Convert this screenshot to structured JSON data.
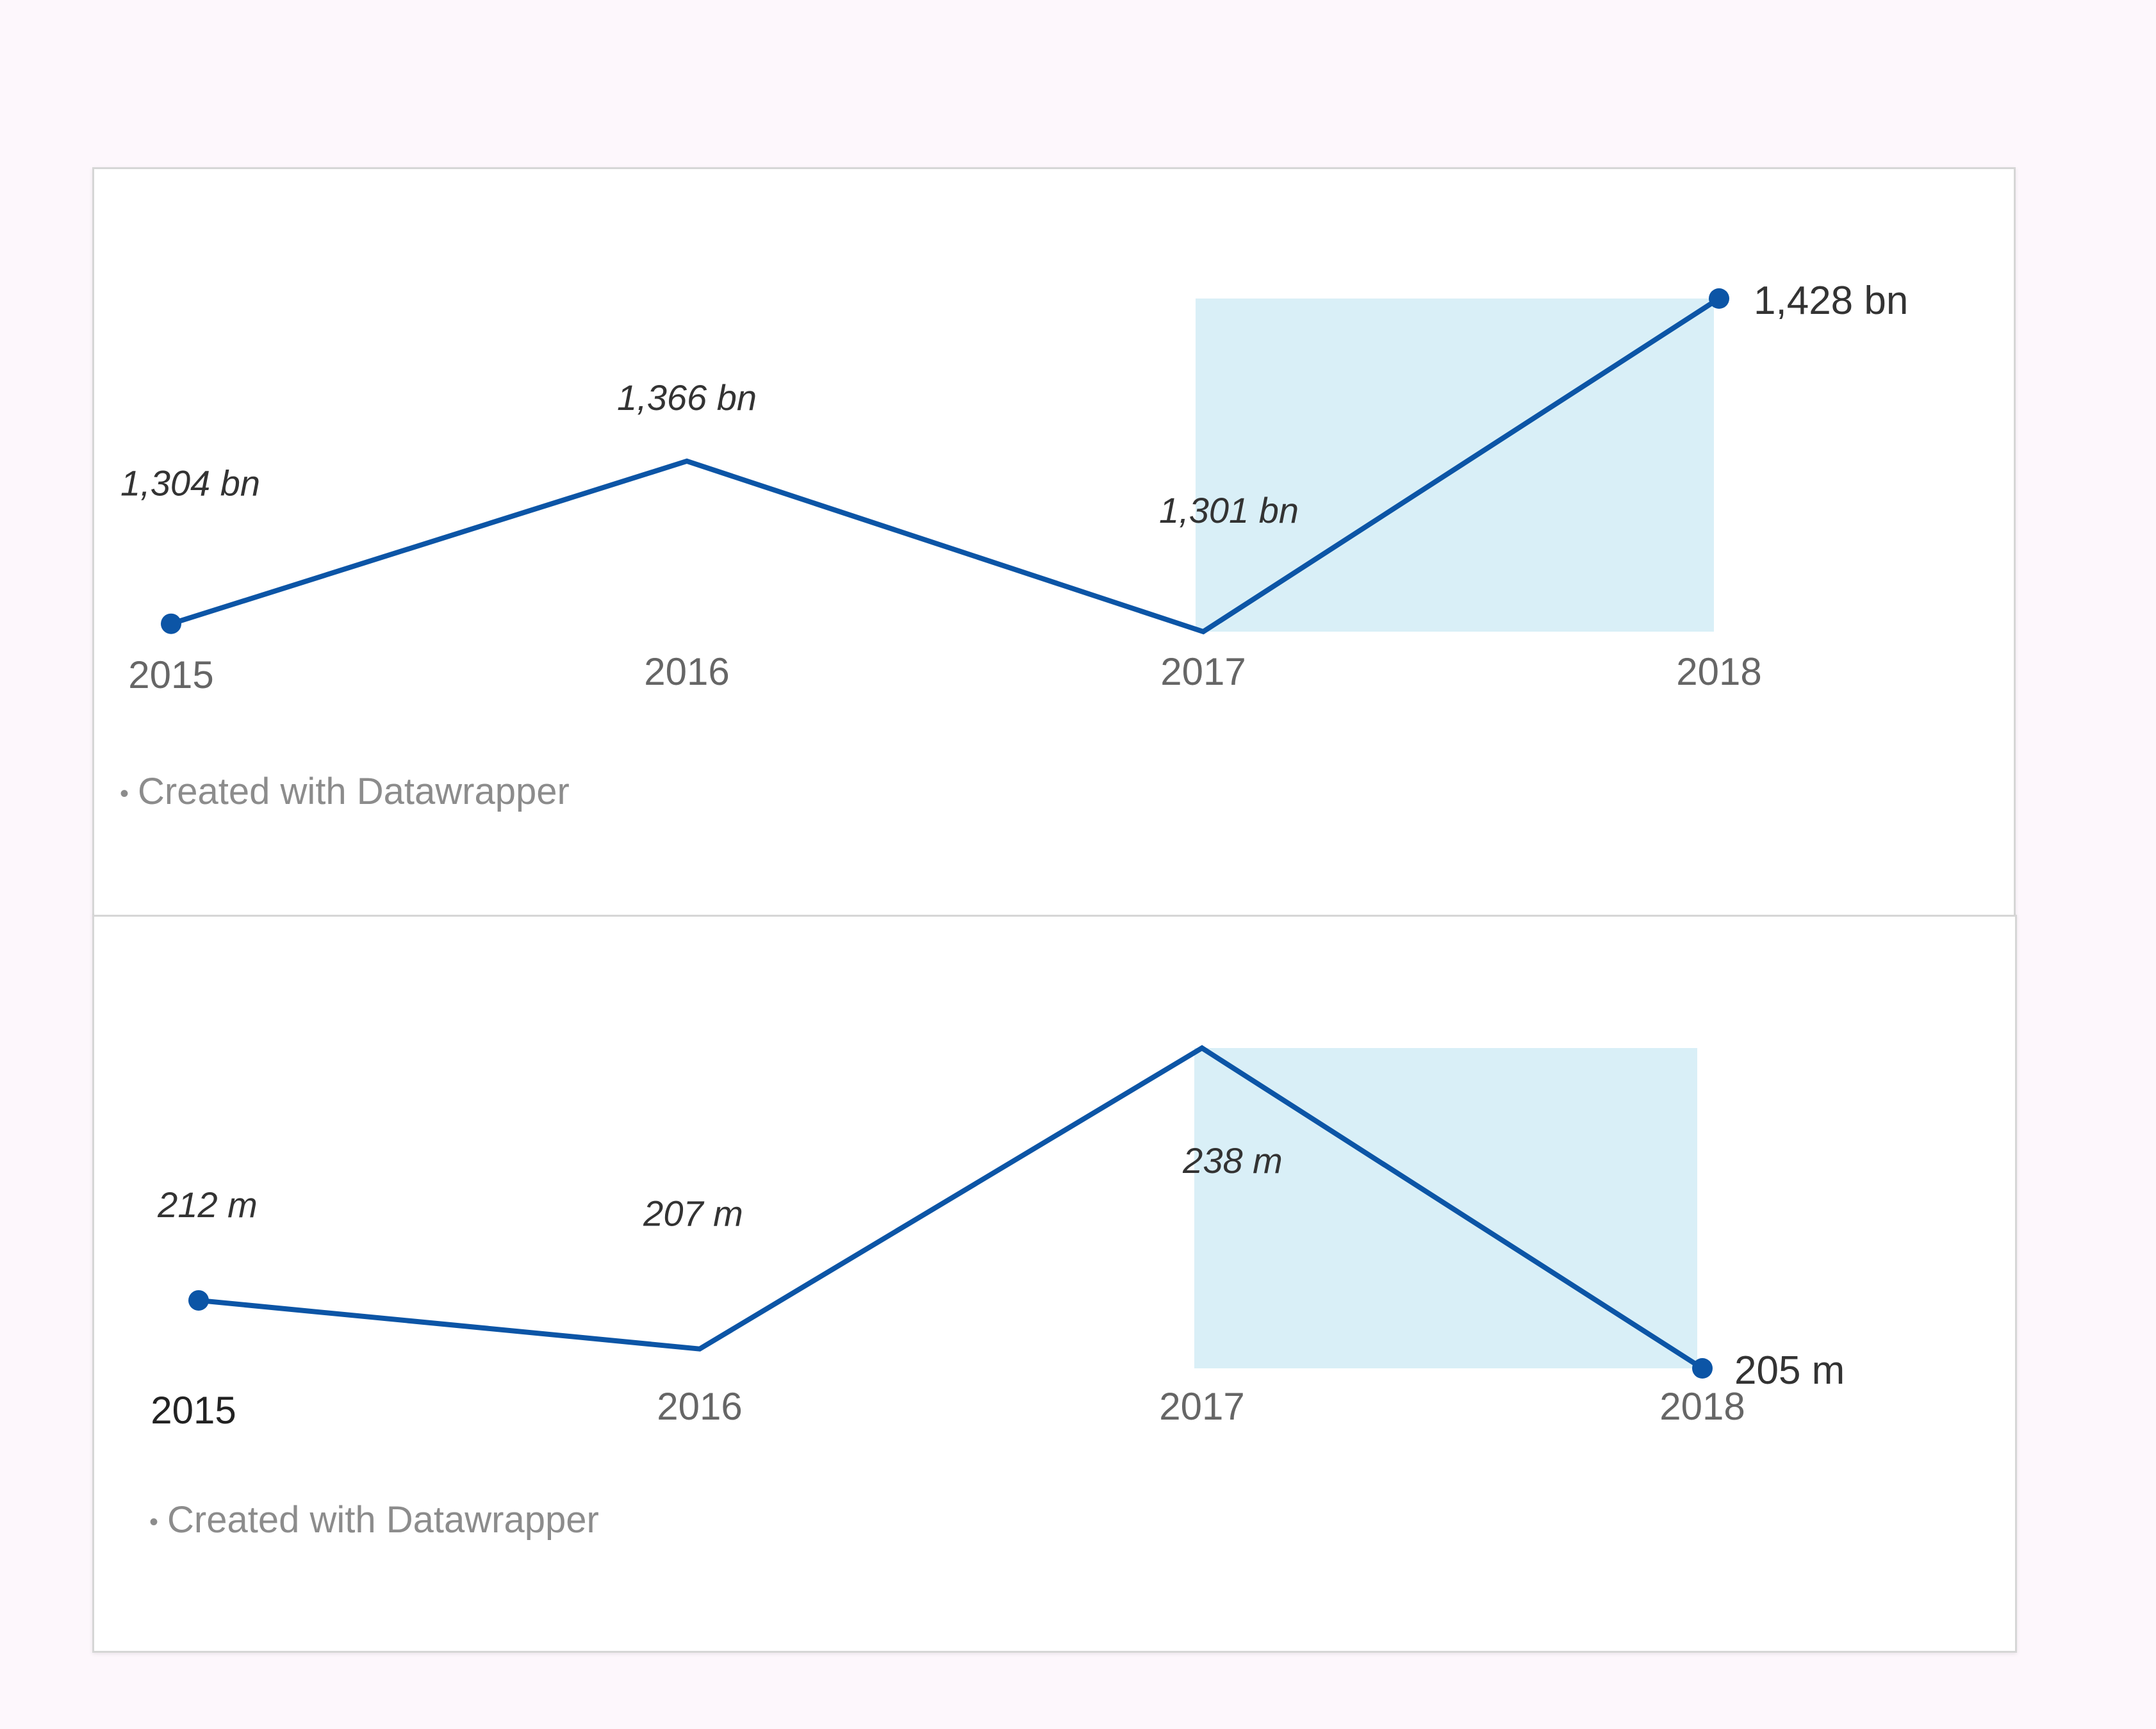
{
  "colors": {
    "line": "#0c55a6",
    "highlight": "#d9eff7",
    "label": "#333333",
    "tick": "#666666",
    "credit": "#8c8c8c"
  },
  "chart_data": [
    {
      "type": "line",
      "x": [
        "2015",
        "2016",
        "2017",
        "2018"
      ],
      "values": [
        1304,
        1366,
        1301,
        1428
      ],
      "unit_suffix": "bn",
      "point_labels": [
        "1,304 bn",
        "1,366 bn",
        "1,301 bn",
        "1,428 bn"
      ],
      "highlight_range": [
        "2017",
        "2018"
      ],
      "markers_on": [
        "2015",
        "2018"
      ],
      "grid": false,
      "legend": "none",
      "credit": "Created with Datawrapper"
    },
    {
      "type": "line",
      "x": [
        "2015",
        "2016",
        "2017",
        "2018"
      ],
      "values": [
        212,
        207,
        238,
        205
      ],
      "unit_suffix": "m",
      "point_labels": [
        "212 m",
        "207 m",
        "238 m",
        "205 m"
      ],
      "highlight_range": [
        "2017",
        "2018"
      ],
      "markers_on": [
        "2015",
        "2018"
      ],
      "grid": false,
      "legend": "none",
      "credit": "Created with Datawrapper"
    }
  ]
}
